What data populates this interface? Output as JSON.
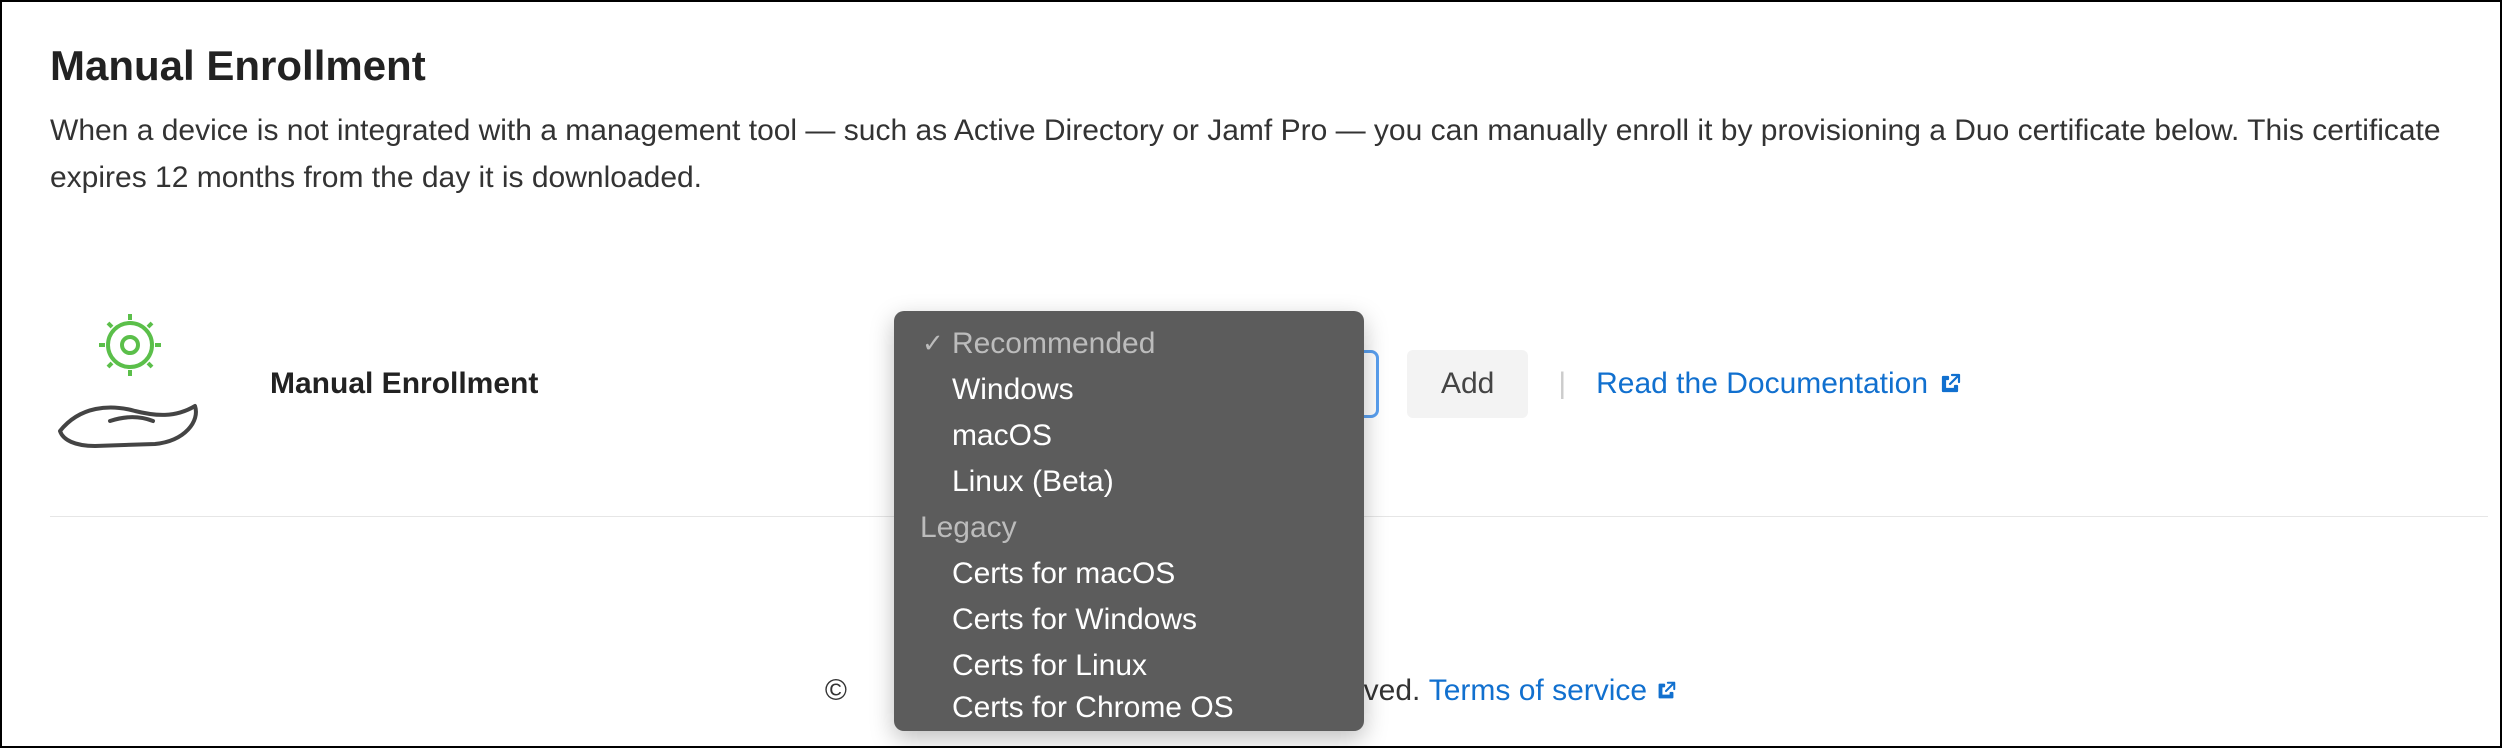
{
  "header": {
    "title": "Manual Enrollment",
    "description": "When a device is not integrated with a management tool — such as Active Directory or Jamf Pro — you can manually enroll it by provisioning a Duo certificate below. This certificate expires 12 months from the day it is downloaded."
  },
  "enroll": {
    "label": "Manual Enrollment",
    "add_label": "Add",
    "doc_link_label": "Read the Documentation"
  },
  "dropdown": {
    "group1_label": "Recommended",
    "group1": {
      "opt1": "Windows",
      "opt2": "macOS",
      "opt3": "Linux (Beta)"
    },
    "group2_label": "Legacy",
    "group2": {
      "opt1": "Certs for macOS",
      "opt2": "Certs for Windows",
      "opt3": "Certs for Linux",
      "opt4_truncated": "Certs for Chrome OS"
    }
  },
  "footer": {
    "copyright_symbol": "©",
    "rights_fragment": "rved.",
    "tos_label": "Terms of service"
  }
}
